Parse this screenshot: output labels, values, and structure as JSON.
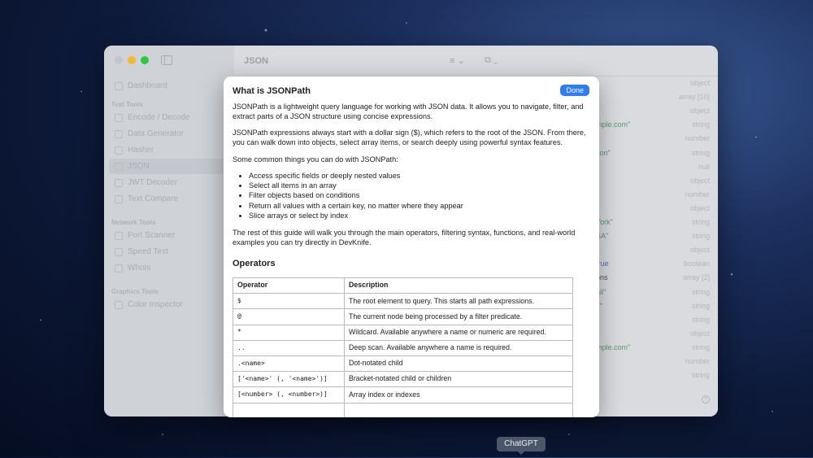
{
  "window": {
    "title": "JSON"
  },
  "sidebar": {
    "dashboard": "Dashboard",
    "sections": [
      {
        "title": "Text Tools",
        "items": [
          "Encode / Decode",
          "Data Generator",
          "Hasher",
          "JSON",
          "JWT Decoder",
          "Text Compare"
        ]
      },
      {
        "title": "Network Tools",
        "items": [
          "Port Scanner",
          "Speed Test",
          "WhoIs"
        ]
      },
      {
        "title": "Graphics Tools",
        "items": [
          "Color Inspector"
        ]
      }
    ],
    "active": "JSON"
  },
  "tree": {
    "types": [
      "object",
      "array [10]",
      "object",
      "string",
      "number",
      "string",
      "null",
      "object",
      "number",
      "object",
      "string",
      "string",
      "object",
      "boolean",
      "array [2]",
      "string",
      "string",
      "string",
      "object",
      "string",
      "number",
      "string"
    ],
    "fragments": [
      "",
      "",
      "",
      "mple.com\"",
      "",
      "son\"",
      "",
      "",
      "",
      "",
      "York\"",
      "SA\"",
      ":",
      "true",
      "ons",
      "ail\"",
      "s\"",
      "",
      "",
      "mple.com\"",
      "",
      "\""
    ]
  },
  "modal": {
    "title": "What is JSONPath",
    "done": "Done",
    "p1": "JSONPath is a lightweight query language for working with JSON data. It allows you to navigate, filter, and extract parts of a JSON structure using concise expressions.",
    "p2": "JSONPath expressions always start with a dollar sign ($), which refers to the root of the JSON. From there, you can walk down into objects, select array items, or search deeply using powerful syntax features.",
    "p3": "Some common things you can do with JSONPath:",
    "bullets": [
      "Access specific fields or deeply nested values",
      "Select all items in an array",
      "Filter objects based on conditions",
      "Return all values with a certain key, no matter where they appear",
      "Slice arrays or select by index"
    ],
    "p4": "The rest of this guide will walk you through the main operators, filtering syntax, functions, and real-world examples you can try directly in DevKnife.",
    "operators_title": "Operators",
    "table": {
      "headers": [
        "Operator",
        "Description"
      ],
      "rows": [
        [
          "$",
          "The root element to query. This starts all path expressions."
        ],
        [
          "@",
          "The current node being processed by a filter predicate."
        ],
        [
          "*",
          "Wildcard. Available anywhere a name or numeric are required."
        ],
        [
          "..",
          "Deep scan. Available anywhere a name is required."
        ],
        [
          ".<name>",
          "Dot-notated child"
        ],
        [
          "['<name>' (, '<name>')]",
          "Bracket-notated child or children"
        ],
        [
          "[<number> (, <number>)]",
          "Array index or indexes"
        ],
        [
          "",
          ""
        ]
      ]
    }
  },
  "tooltip": "ChatGPT",
  "colors": {
    "accent": "#2e7cf6",
    "string": "#5a9a6a",
    "boolean": "#4a6fc9"
  }
}
